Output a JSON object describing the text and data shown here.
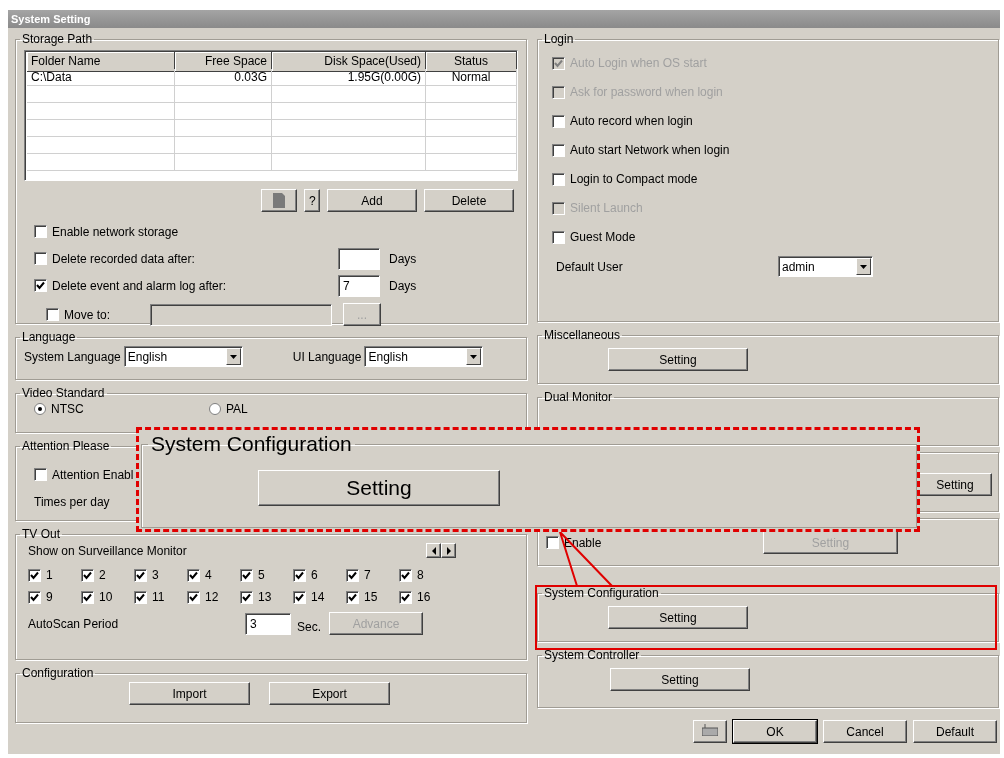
{
  "window": {
    "title": "System Setting"
  },
  "storage_path": {
    "title": "Storage Path",
    "columns": [
      "Folder Name",
      "Free Space",
      "Disk Space(Used)",
      "Status"
    ],
    "rows": [
      [
        "C:\\Data",
        "0.03G",
        "1.95G(0.00G)",
        "Normal"
      ]
    ],
    "buttons": [
      {
        "kind": "icon"
      },
      {
        "kind": "text",
        "label": "?"
      },
      {
        "kind": "text",
        "label": "Add"
      },
      {
        "kind": "text",
        "label": "Delete"
      }
    ],
    "options": [
      {
        "kind": "checkbox",
        "label": "Enable network storage",
        "checked": false
      },
      {
        "kind": "days",
        "label": "Delete recorded data after:",
        "checked": false,
        "unit": "Days"
      },
      {
        "kind": "days",
        "label": "Delete event and alarm log after:",
        "checked": true,
        "value": "7",
        "unit": "Days"
      }
    ],
    "move_to": {
      "label": "Move to:",
      "checked": false,
      "browse": "...",
      "disabled": true
    }
  },
  "language": {
    "title": "Language",
    "fields": [
      {
        "label": "System Language",
        "value": "English"
      },
      {
        "label": "UI Language",
        "value": "English"
      }
    ]
  },
  "video_standard": {
    "title": "Video Standard",
    "options": [
      {
        "label": "NTSC",
        "selected": true
      },
      {
        "label": "PAL",
        "selected": false
      }
    ]
  },
  "attention": {
    "title": "Attention Please",
    "checkbox": {
      "label": "Attention Enabl",
      "checked": false
    },
    "times_label": "Times per day"
  },
  "tv_out": {
    "title": "TV Out",
    "subtitle": "Show on Surveillance Monitor",
    "cameras": [
      {
        "label": "1",
        "checked": true
      },
      {
        "label": "2",
        "checked": true
      },
      {
        "label": "3",
        "checked": true
      },
      {
        "label": "4",
        "checked": true
      },
      {
        "label": "5",
        "checked": true
      },
      {
        "label": "6",
        "checked": true
      },
      {
        "label": "7",
        "checked": true
      },
      {
        "label": "8",
        "checked": true
      },
      {
        "label": "9",
        "checked": true
      },
      {
        "label": "10",
        "checked": true
      },
      {
        "label": "11",
        "checked": true
      },
      {
        "label": "12",
        "checked": true
      },
      {
        "label": "13",
        "checked": true
      },
      {
        "label": "14",
        "checked": true
      },
      {
        "label": "15",
        "checked": true
      },
      {
        "label": "16",
        "checked": true
      }
    ],
    "autoscan": {
      "label": "AutoScan Period",
      "value": "3",
      "unit": "Sec.",
      "button": "Advance",
      "disabled": true
    }
  },
  "configuration": {
    "title": "Configuration",
    "buttons": [
      "Import",
      "Export"
    ]
  },
  "login": {
    "title": "Login",
    "options": [
      {
        "label": "Auto Login when OS start",
        "checked": true,
        "disabled": true
      },
      {
        "label": "Ask for password when login",
        "checked": false,
        "disabled": true
      },
      {
        "label": "Auto record when login",
        "checked": false,
        "disabled": false
      },
      {
        "label": "Auto start Network when login",
        "checked": false,
        "disabled": false
      },
      {
        "label": "Login to Compact mode",
        "checked": false,
        "disabled": false
      },
      {
        "label": "Silent Launch",
        "checked": false,
        "disabled": true
      },
      {
        "label": "Guest Mode",
        "checked": false,
        "disabled": false
      }
    ],
    "default_user": {
      "label": "Default User",
      "value": "admin"
    }
  },
  "miscellaneous": {
    "title": "Miscellaneous",
    "button": "Setting"
  },
  "dual_monitor": {
    "title": "Dual Monitor"
  },
  "group_6": {
    "button": "Setting",
    "disabled": false
  },
  "group_7": {
    "checkbox": {
      "label": "Enable",
      "checked": false
    },
    "button": "Setting",
    "disabled": true
  },
  "system_configuration": {
    "title": "System Configuration",
    "button": "Setting",
    "highlighted": true
  },
  "system_controller": {
    "title": "System Controller",
    "button": "Setting"
  },
  "footer_buttons": [
    {
      "kind": "icon",
      "default": false
    },
    {
      "kind": "text",
      "label": "OK",
      "default": true
    },
    {
      "kind": "text",
      "label": "Cancel",
      "default": false
    },
    {
      "kind": "text",
      "label": "Default",
      "default": false
    }
  ],
  "callout": {
    "title": "System Configuration",
    "button": "Setting"
  }
}
